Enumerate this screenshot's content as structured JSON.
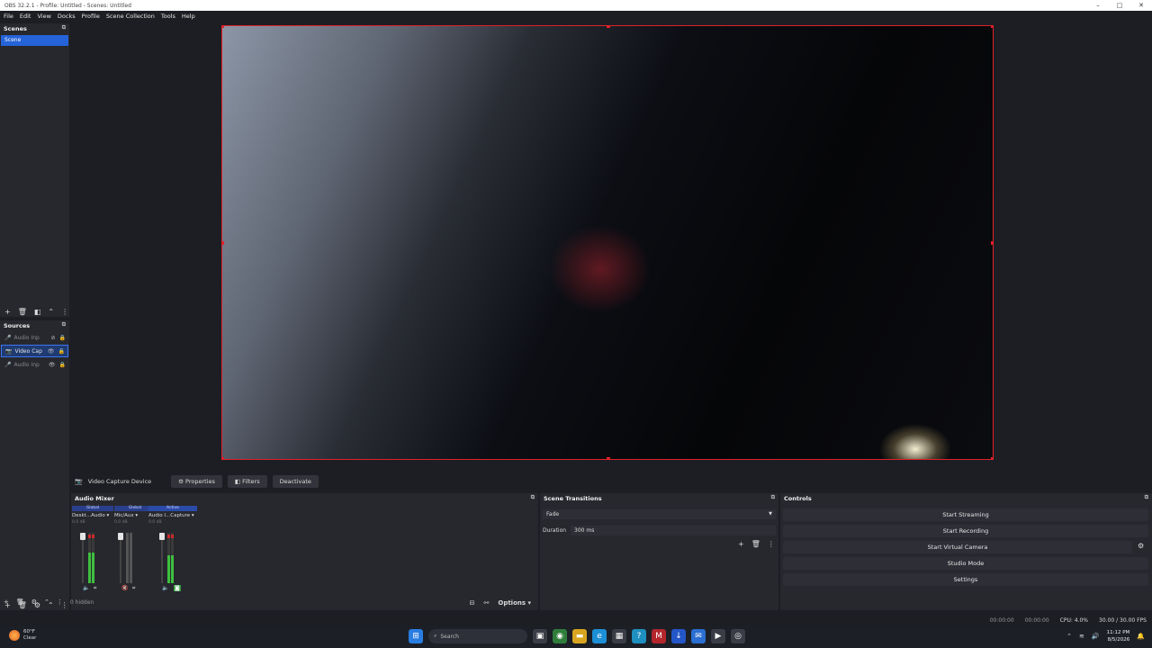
{
  "window": {
    "title": "OBS 32.2.1 - Profile: Untitled - Scenes: Untitled"
  },
  "menu": [
    "File",
    "Edit",
    "View",
    "Docks",
    "Profile",
    "Scene Collection",
    "Tools",
    "Help"
  ],
  "scenes": {
    "title": "Scenes",
    "items": [
      "Scene"
    ]
  },
  "sources": {
    "title": "Sources",
    "items": [
      {
        "label": "Audio Inp",
        "icon": "mic-icon",
        "selected": false
      },
      {
        "label": "Video Cap",
        "icon": "camera-icon",
        "selected": true
      },
      {
        "label": "Audio Inp",
        "icon": "mic-icon",
        "selected": false
      }
    ]
  },
  "source_toolbar": {
    "source_name": "Video Capture Device",
    "properties": "Properties",
    "filters": "Filters",
    "deactivate": "Deactivate"
  },
  "audio_mixer": {
    "title": "Audio Mixer",
    "hidden_label": "0 hidden",
    "options": "Options",
    "channels": [
      {
        "tag": "Global",
        "name": "Deskt...Audio",
        "db": "0.0 dB",
        "level": 0.6
      },
      {
        "tag": "Global",
        "name": "Mic/Aux",
        "db": "0.0 dB",
        "level": 0.0
      },
      {
        "tag": "Active",
        "name": "Audio I...Capture",
        "db": "0.0 dB",
        "level": 0.55
      }
    ]
  },
  "scene_transitions": {
    "title": "Scene Transitions",
    "selected": "Fade",
    "duration_label": "Duration",
    "duration_value": "300 ms"
  },
  "controls": {
    "title": "Controls",
    "start_streaming": "Start Streaming",
    "start_recording": "Start Recording",
    "start_virtual_camera": "Start Virtual Camera",
    "studio_mode": "Studio Mode",
    "settings": "Settings"
  },
  "status": {
    "stream_time": "00:00:00",
    "rec_time": "00:00:00",
    "cpu": "CPU: 4.0%",
    "fps": "30.00 / 30.00 FPS"
  },
  "taskbar": {
    "temp": "60°F",
    "weather": "Clear",
    "search": "Search",
    "time": "11:12 PM",
    "date": "8/5/2026"
  },
  "colors": {
    "accent": "#2563d9",
    "selection_border": "#e0202a"
  }
}
